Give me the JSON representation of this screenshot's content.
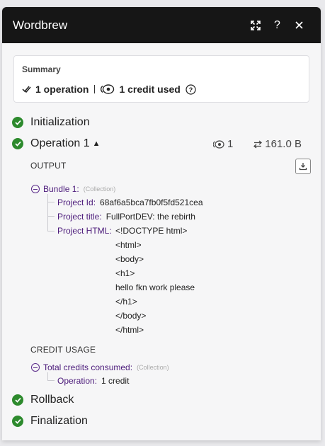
{
  "header": {
    "title": "Wordbrew"
  },
  "summary": {
    "label": "Summary",
    "operations": "1 operation",
    "credits": "1 credit used"
  },
  "steps": {
    "initialization": "Initialization",
    "operation": "Operation 1",
    "rollback": "Rollback",
    "finalization": "Finalization"
  },
  "op_stats": {
    "operations": "1",
    "size": "161.0 B"
  },
  "output": {
    "heading": "OUTPUT",
    "bundle_label": "Bundle 1:",
    "bundle_type": "(Collection)",
    "project_id_key": "Project Id:",
    "project_id_value": "68af6a5bca7fb0f5fd521cea",
    "project_title_key": "Project title:",
    "project_title_value": "FullPortDEV: the rebirth",
    "project_html_key": "Project HTML:",
    "html_lines": [
      "<!DOCTYPE html>",
      "<html>",
      "<body>",
      "<h1>",
      "hello fkn work please",
      "</h1>",
      "</body>",
      "</html>"
    ]
  },
  "credit_usage": {
    "heading": "CREDIT USAGE",
    "total_label": "Total credits consumed:",
    "total_type": "(Collection)",
    "operation_key": "Operation:",
    "operation_value": "1 credit"
  },
  "colors": {
    "header_bg": "#161616",
    "success": "#2d8a2d",
    "key": "#4b1a7a"
  }
}
